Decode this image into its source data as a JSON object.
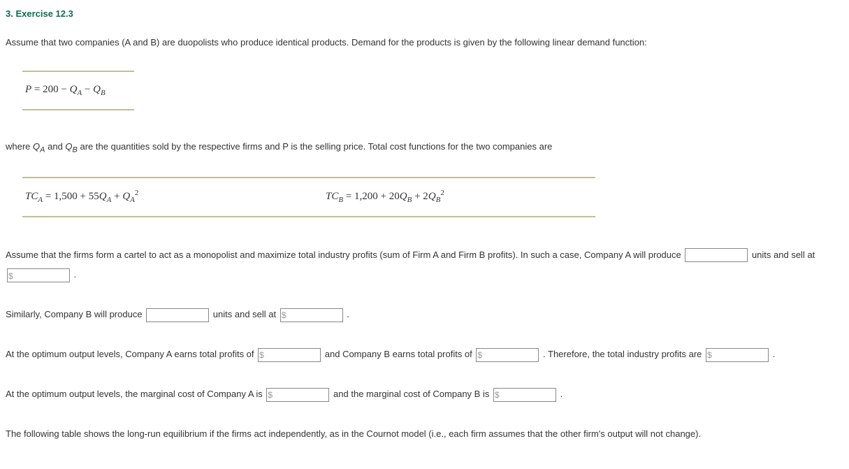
{
  "heading": "3. Exercise 12.3",
  "p1": "Assume that two companies (A and B) are duopolists who produce identical products. Demand for the products is given by the following linear demand function:",
  "eq_demand_pre": "P",
  "eq_demand_mid": " = 200 − ",
  "eq_demand_qa": "Q",
  "eq_demand_sa": "A",
  "eq_demand_minus": " − ",
  "eq_demand_qb": "Q",
  "eq_demand_sb": "B",
  "p2_a": "where ",
  "p2_qa": "Q",
  "p2_sa": "A",
  "p2_and": " and ",
  "p2_qb": "Q",
  "p2_sb": "B",
  "p2_b": " are the quantities sold by the respective firms and P is the selling price. Total cost functions for the two companies are",
  "tca_pre": "TC",
  "tca_sub": "A",
  "tca_eq": " = 1,500 + 55",
  "tca_q1": "Q",
  "tca_s1": "A",
  "tca_plus": " + ",
  "tca_q2": "Q",
  "tca_s2": "A",
  "tca_sup": "2",
  "tcb_pre": "TC",
  "tcb_sub": "B",
  "tcb_eq": " = 1,200 + 20",
  "tcb_q1": "Q",
  "tcb_s1": "B",
  "tcb_plus": " + 2",
  "tcb_q2": "Q",
  "tcb_s2": "B",
  "tcb_sup": "2",
  "p3": "Assume that the firms form a cartel to act as a monopolist and maximize total industry profits (sum of Firm A and Firm B profits). In such a case, Company A will produce ",
  "p3_units": " units and sell at ",
  "p3_end": " .",
  "p4_a": "Similarly, Company B will produce ",
  "p4_units": " units and sell at ",
  "p4_end": " .",
  "p5_a": "At the optimum output levels, Company A earns total profits of ",
  "p5_b": " and Company B earns total profits of ",
  "p5_c": " . Therefore, the total industry profits are ",
  "p5_end": " .",
  "p6_a": "At the optimum output levels, the marginal cost of Company A is ",
  "p6_b": " and the marginal cost of Company B is ",
  "p6_end": " .",
  "p7": "The following table shows the long-run equilibrium if the firms act independently, as in the Cournot model (i.e., each firm assumes that the other firm's output will not change).",
  "dollar": "$"
}
